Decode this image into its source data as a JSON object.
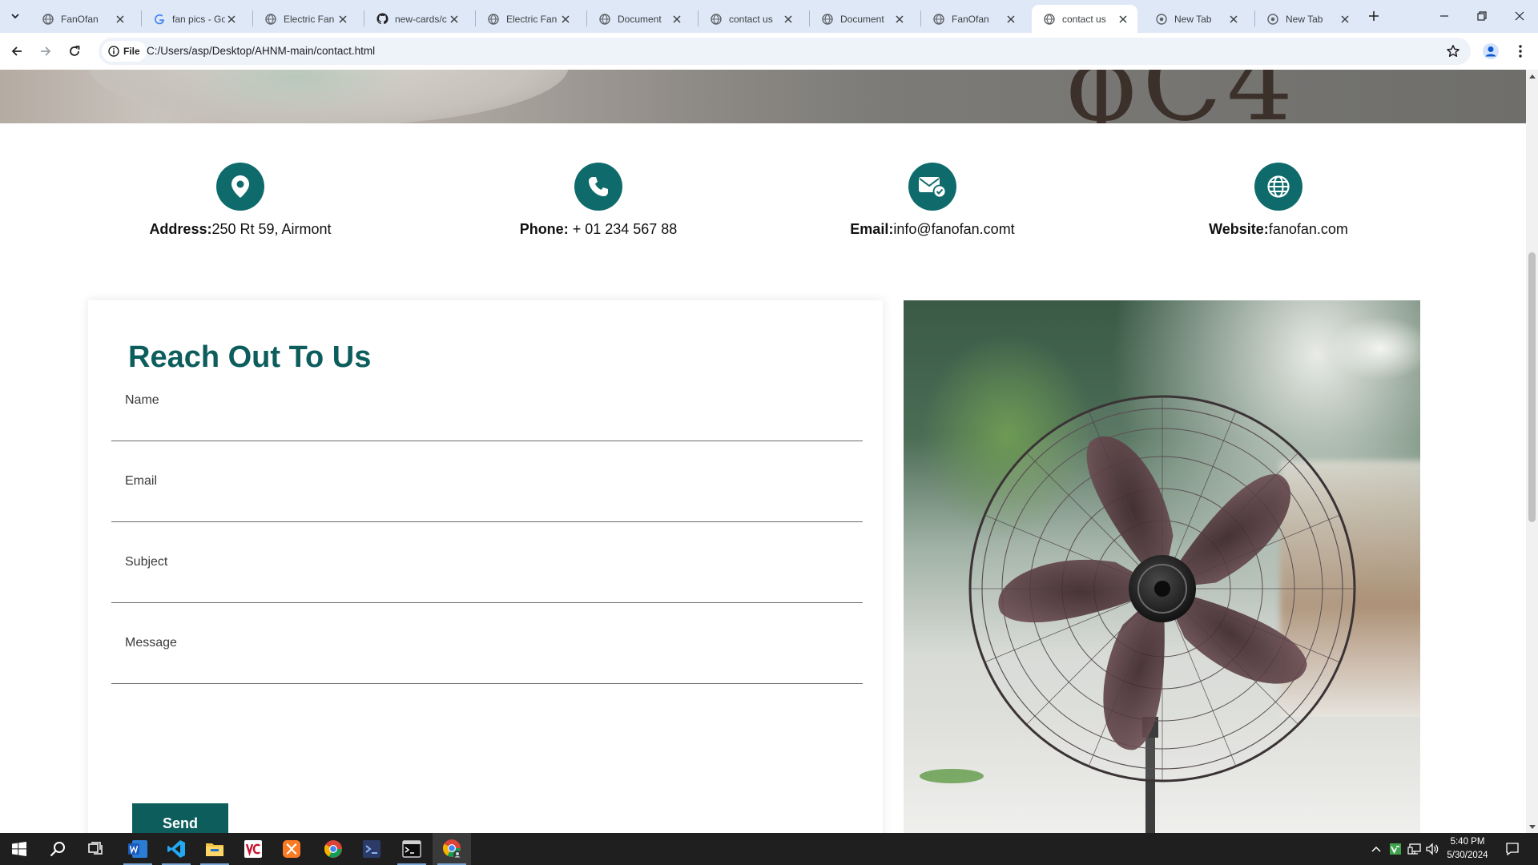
{
  "browser": {
    "tabs": [
      {
        "title": "FanOfan",
        "icon": "globe-icon",
        "active": false
      },
      {
        "title": "fan pics - Go",
        "icon": "google-icon",
        "active": false
      },
      {
        "title": "Electric Fan C",
        "icon": "globe-icon",
        "active": false
      },
      {
        "title": "new-cards/c",
        "icon": "github-icon",
        "active": false
      },
      {
        "title": "Electric Fan C",
        "icon": "globe-icon",
        "active": false
      },
      {
        "title": "Document",
        "icon": "globe-icon",
        "active": false
      },
      {
        "title": "contact us",
        "icon": "globe-icon",
        "active": false
      },
      {
        "title": "Document",
        "icon": "globe-icon",
        "active": false
      },
      {
        "title": "FanOfan",
        "icon": "globe-icon",
        "active": false
      },
      {
        "title": "contact us",
        "icon": "globe-icon",
        "active": true
      },
      {
        "title": "New Tab",
        "icon": "chrome-icon",
        "active": false
      },
      {
        "title": "New Tab",
        "icon": "chrome-icon",
        "active": false
      }
    ],
    "site_chip": "File",
    "url": "C:/Users/asp/Desktop/AHNM-main/contact.html"
  },
  "page": {
    "hero": {
      "brand_fragment": "ɸC4"
    },
    "contact_info": [
      {
        "label": "Address:",
        "value": "250 Rt 59, Airmont",
        "icon": "location-pin-icon"
      },
      {
        "label": "Phone:",
        "value": " + 01 234 567 88",
        "icon": "phone-icon"
      },
      {
        "label": "Email:",
        "value": "info@fanofan.comt",
        "icon": "email-icon"
      },
      {
        "label": "Website:",
        "value": "fanofan.com",
        "icon": "globe-icon"
      }
    ],
    "form": {
      "title": "Reach Out To Us",
      "fields": [
        {
          "label": "Name",
          "value": ""
        },
        {
          "label": "Email",
          "value": ""
        },
        {
          "label": "Subject",
          "value": ""
        },
        {
          "label": "Message",
          "value": ""
        }
      ],
      "send_label": "Send"
    }
  },
  "colors": {
    "accent": "#0f6b6b",
    "title": "#0d5d5d",
    "button": "#0d5d5d",
    "tabstrip": "#dfe8f7",
    "taskbar": "#1f1f1f"
  },
  "taskbar": {
    "apps": [
      "windows-start-icon",
      "search-icon",
      "task-view-icon",
      "word-icon",
      "vscode-icon",
      "file-explorer-icon",
      "vc-app-icon",
      "xampp-icon",
      "chrome-icon",
      "visual-studio-icon",
      "terminal-icon",
      "chrome-active-icon"
    ],
    "time": "5:40 PM",
    "date": "5/30/2024"
  }
}
